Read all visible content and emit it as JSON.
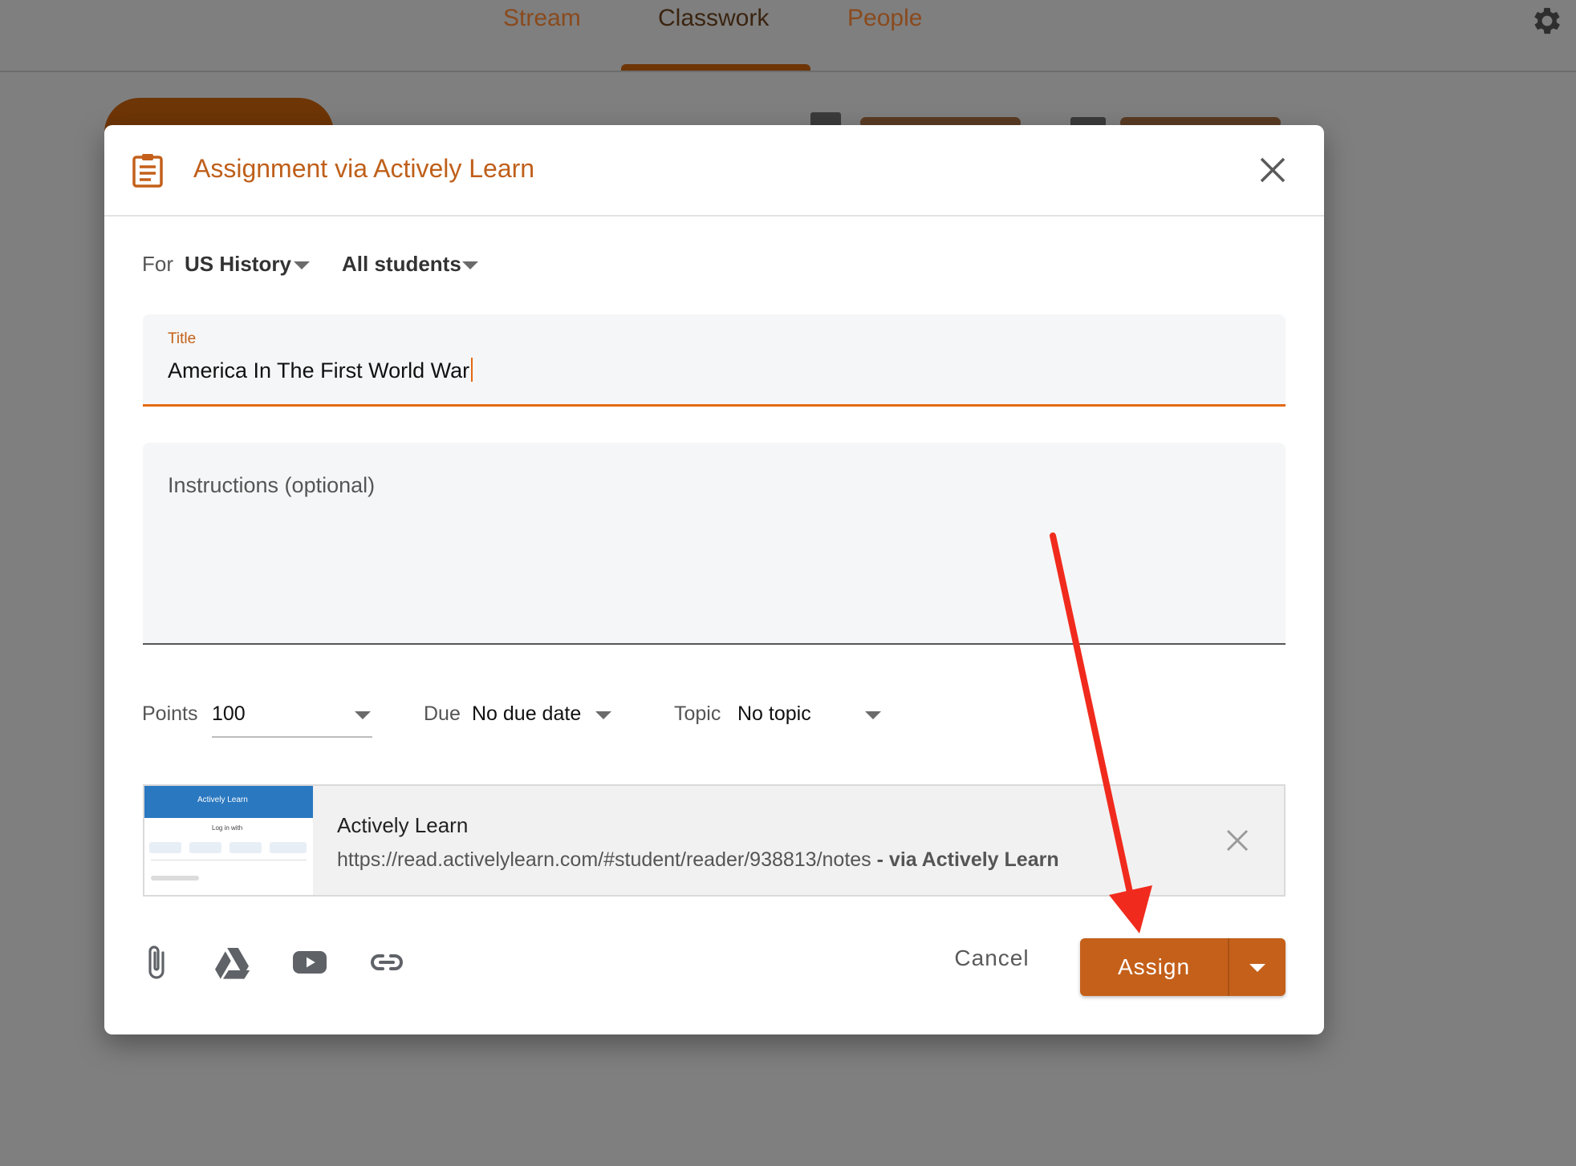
{
  "nav": {
    "tabs": [
      {
        "label": "Stream"
      },
      {
        "label": "Classwork"
      },
      {
        "label": "People"
      }
    ],
    "active_tab": "Classwork",
    "settings_icon": "gear-icon"
  },
  "dialog": {
    "title": "Assignment via Actively Learn",
    "header_icon": "assignment-icon",
    "close_icon": "close-icon",
    "for_label": "For",
    "class_value": "US History",
    "students_value": "All students",
    "title_field": {
      "label": "Title",
      "value": "America In The First World War"
    },
    "instructions_field": {
      "placeholder": "Instructions (optional)",
      "value": ""
    },
    "points": {
      "label": "Points",
      "value": "100"
    },
    "due": {
      "label": "Due",
      "value": "No due date"
    },
    "topic": {
      "label": "Topic",
      "value": "No topic"
    },
    "attachment": {
      "title": "Actively Learn",
      "url": "https://read.activelylearn.com/#student/reader/938813/notes",
      "via": "- via Actively Learn",
      "thumbnail_logo": "Actively Learn",
      "thumbnail_login": "Log in with"
    },
    "toolbar_icons": [
      "paperclip-icon",
      "google-drive-icon",
      "youtube-icon",
      "link-icon"
    ],
    "cancel_label": "Cancel",
    "assign_label": "Assign"
  },
  "colors": {
    "accent": "#c4601a",
    "title_text": "#bf5f1a",
    "focus_underline": "#e46a12",
    "annotation_arrow": "#f02b1d"
  }
}
